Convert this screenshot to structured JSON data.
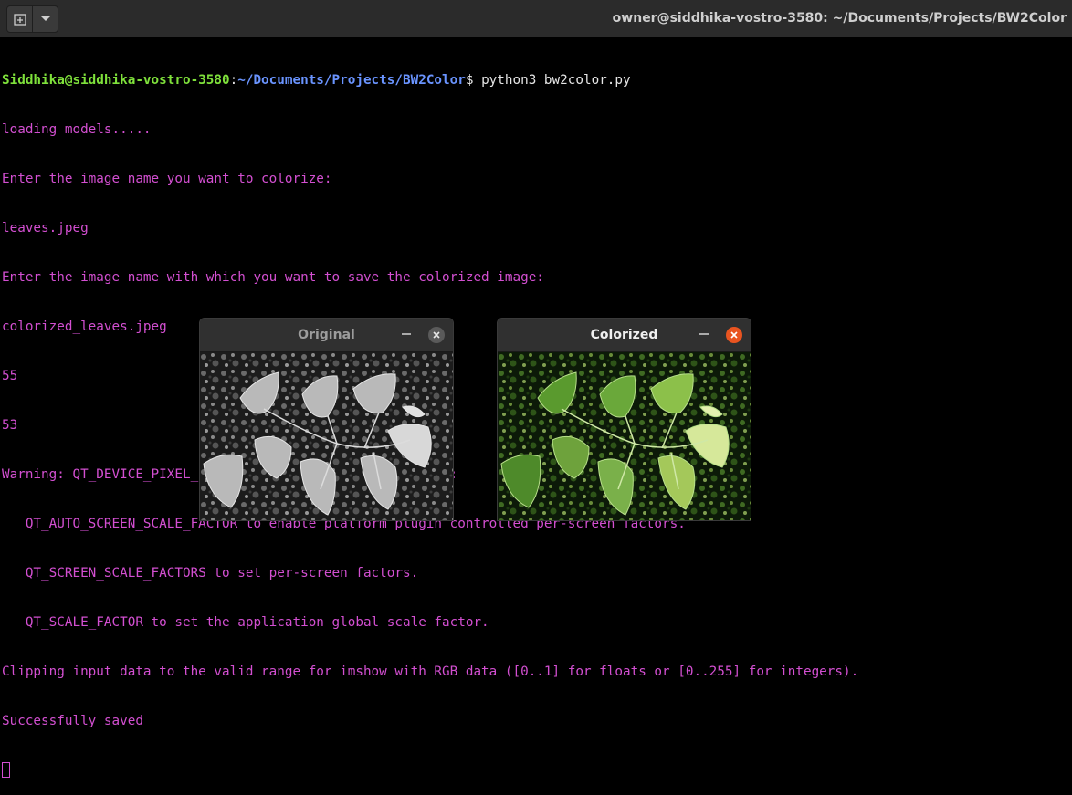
{
  "window": {
    "title": "owner@siddhika-vostro-3580: ~/Documents/Projects/BW2Color",
    "new_tab_icon": "new-tab-icon",
    "menu_icon": "dropdown-arrow-icon"
  },
  "terminal": {
    "prompt": {
      "user_host": "Siddhika@siddhika-vostro-3580",
      "colon": ":",
      "path": "~/Documents/Projects/BW2Color",
      "dollar": "$",
      "command": " python3 bw2color.py"
    },
    "lines": [
      "loading models.....",
      "Enter the image name you want to colorize:",
      "leaves.jpeg",
      "Enter the image name with which you want to save the colorized image:",
      "colorized_leaves.jpeg",
      "55",
      "53",
      "Warning: QT_DEVICE_PIXEL_RATIO is deprecated. Instead use:",
      "   QT_AUTO_SCREEN_SCALE_FACTOR to enable platform plugin controlled per-screen factors.",
      "   QT_SCREEN_SCALE_FACTORS to set per-screen factors.",
      "   QT_SCALE_FACTOR to set the application global scale factor.",
      "Clipping input data to the valid range for imshow with RGB data ([0..1] for floats or [0..255] for integers).",
      "Successfully saved"
    ],
    "colors": {
      "output": "#d34fd1",
      "user_host": "#7fe13b",
      "path": "#6a94ff",
      "background": "#000000"
    }
  },
  "windows": {
    "original": {
      "title": "Original",
      "image": "grayscale-leaves-photo"
    },
    "colorized": {
      "title": "Colorized",
      "image": "colorized-green-leaves-photo"
    },
    "close_accent": "#e95420"
  }
}
